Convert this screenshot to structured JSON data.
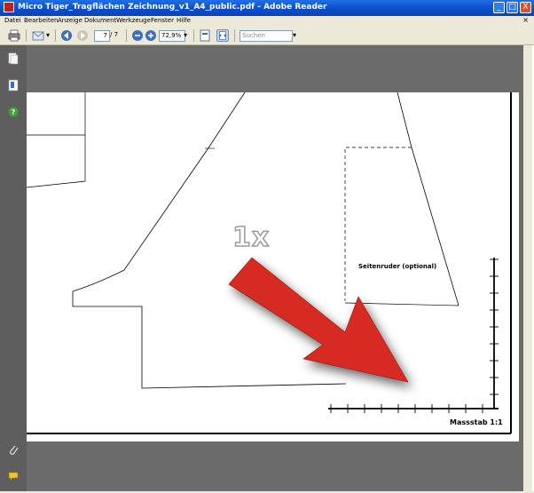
{
  "window": {
    "title": "Micro Tiger_Tragflächen Zeichnung_v1_A4_public.pdf - Adobe Reader",
    "controls": [
      "_",
      "□",
      "X"
    ]
  },
  "menubar": {
    "items": [
      "Datei",
      "Bearbeiten",
      "Anzeige",
      "Dokument",
      "Werkzeuge",
      "Fenster",
      "Hilfe"
    ],
    "close": "×"
  },
  "toolbar": {
    "page_current": "7",
    "page_total": "/ 7",
    "zoom": "72,9%",
    "search_placeholder": "Suchen"
  },
  "document": {
    "copies_label": "1x",
    "rudder_label": "Seitenruder (optional)",
    "scale_label": "Massstab 1:1"
  },
  "colors": {
    "arrow": "#d62a20",
    "titlebar": "#0a4cc8",
    "viewport": "#6b6b6b"
  }
}
